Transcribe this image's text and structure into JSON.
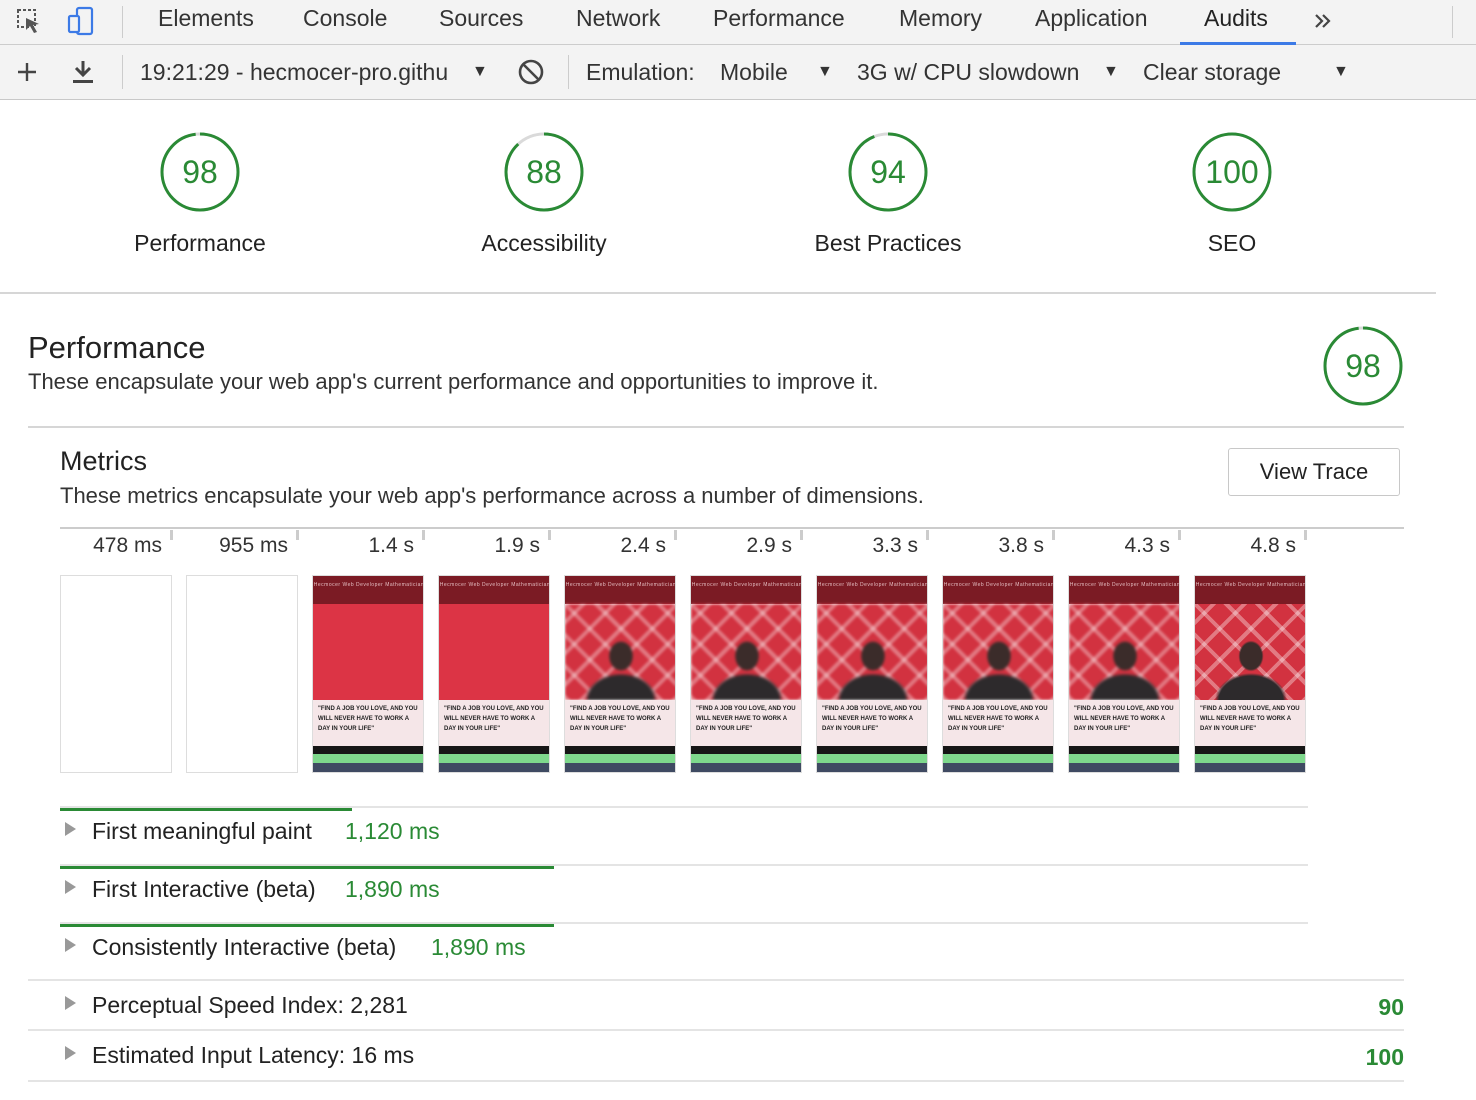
{
  "devtools": {
    "tabs": [
      "Elements",
      "Console",
      "Sources",
      "Network",
      "Performance",
      "Memory",
      "Application",
      "Audits"
    ],
    "overflow_icon": "chevron-double-right-icon"
  },
  "toolbar": {
    "report_select": "19:21:29 - hecmocer-pro.githu",
    "emulation_label": "Emulation:",
    "emulation_value": "Mobile",
    "throttling_value": "3G w/ CPU slowdown",
    "storage_value": "Clear storage"
  },
  "scores": [
    {
      "label": "Performance",
      "value": "98",
      "fraction": 0.98
    },
    {
      "label": "Accessibility",
      "value": "88",
      "fraction": 0.88
    },
    {
      "label": "Best Practices",
      "value": "94",
      "fraction": 0.94
    },
    {
      "label": "SEO",
      "value": "100",
      "fraction": 1.0
    }
  ],
  "performance": {
    "title": "Performance",
    "description": "These encapsulate your web app's current performance and opportunities to improve it.",
    "score": "98",
    "score_fraction": 0.98
  },
  "metrics": {
    "title": "Metrics",
    "description": "These metrics encapsulate your web app's performance across a number of dimensions.",
    "view_trace": "View Trace",
    "timeline": [
      "478 ms",
      "955 ms",
      "1.4 s",
      "1.9 s",
      "2.4 s",
      "2.9 s",
      "3.3 s",
      "3.8 s",
      "4.3 s",
      "4.8 s"
    ],
    "filmstrip": {
      "header_text": "Hecmocer Web Developer Mathematician",
      "quote_text": "\"FIND A JOB YOU LOVE, AND YOU WILL NEVER HAVE TO WORK A DAY IN YOUR LIFE\""
    },
    "rows": [
      {
        "label": "First meaningful paint",
        "value": "1,120 ms",
        "bar_fraction": 0.234
      },
      {
        "label": "First Interactive (beta)",
        "value": "1,890 ms",
        "bar_fraction": 0.396
      },
      {
        "label": "Consistently Interactive (beta)",
        "value": "1,890 ms",
        "bar_fraction": 0.396
      },
      {
        "label": "Perceptual Speed Index: 2,281",
        "score": "90"
      },
      {
        "label": "Estimated Input Latency: 16 ms",
        "score": "100"
      }
    ]
  }
}
